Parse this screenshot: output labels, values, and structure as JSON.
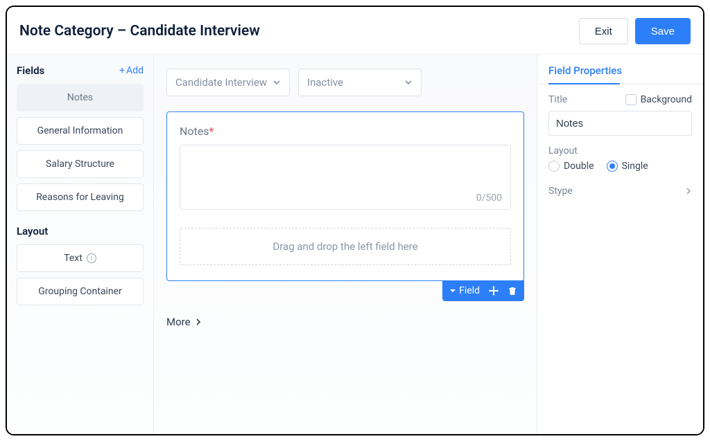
{
  "header": {
    "title": "Note Category – Candidate Interview",
    "exit_label": "Exit",
    "save_label": "Save"
  },
  "sidebar": {
    "fields_title": "Fields",
    "add_label": "Add",
    "fields": [
      {
        "label": "Notes",
        "active": true
      },
      {
        "label": "General Information",
        "active": false
      },
      {
        "label": "Salary Structure",
        "active": false
      },
      {
        "label": "Reasons for Leaving",
        "active": false
      }
    ],
    "layout_title": "Layout",
    "layout_items": [
      {
        "label": "Text",
        "has_info": true
      },
      {
        "label": "Grouping Container",
        "has_info": false
      }
    ]
  },
  "canvas": {
    "dropdowns": [
      {
        "label": "Candidate Interview"
      },
      {
        "label": "Inactive"
      }
    ],
    "card": {
      "label": "Notes",
      "required": true,
      "counter": "0/500",
      "dropzone_text": "Drag and drop the left field here",
      "toolbar_field_label": "Field"
    },
    "more_label": "More"
  },
  "props": {
    "tab_label": "Field Properties",
    "title_label": "Title",
    "background_label": "Background",
    "title_value": "Notes",
    "layout_label": "Layout",
    "layout_options": {
      "double": "Double",
      "single": "Single"
    },
    "layout_selected": "single",
    "stype_label": "Stype"
  }
}
